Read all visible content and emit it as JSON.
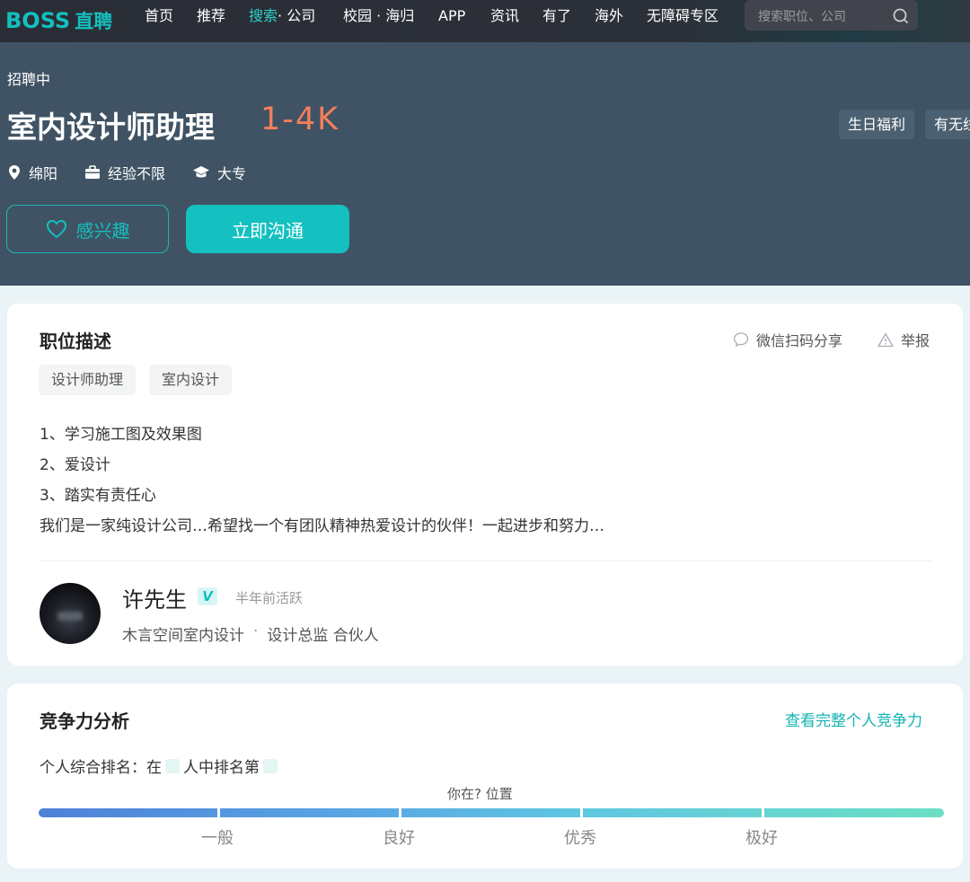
{
  "nav": {
    "logo_main": "BOSS",
    "logo_sub": "直聘",
    "items": [
      "首页",
      "推荐",
      "搜索",
      "· 公司",
      "校园 · 海归",
      "APP",
      "资讯",
      "有了",
      "海外",
      "无障碍专区"
    ],
    "search_placeholder": "搜索职位、公司"
  },
  "job": {
    "status": "招聘中",
    "title": "室内设计师助理",
    "salary": "1-4K",
    "benefits": [
      "生日福利",
      "有无线"
    ],
    "location": "绵阳",
    "experience": "经验不限",
    "education": "大专",
    "like_label": "感兴趣",
    "chat_label": "立即沟通"
  },
  "description": {
    "heading": "职位描述",
    "share_label": "微信扫码分享",
    "report_label": "举报",
    "tags": [
      "设计师助理",
      "室内设计"
    ],
    "lines": [
      "1、学习施工图及效果图",
      "2、爱设计",
      "3、踏实有责任心",
      "我们是一家纯设计公司…希望找一个有团队精神热爱设计的伙伴！一起进步和努力…"
    ]
  },
  "recruiter": {
    "name": "许先生",
    "verified_badge": "V",
    "activity": "半年前活跃",
    "company": "木言空间室内设计",
    "separator": "·",
    "role": "设计总监 合伙人"
  },
  "competitiveness": {
    "heading": "竞争力分析",
    "view_full_label": "查看完整个人竞争力",
    "rank_prefix": "个人综合排名：在",
    "rank_middle": "人中排名第",
    "position_label": "你在? 位置",
    "levels": [
      "一般",
      "良好",
      "优秀",
      "极好"
    ]
  },
  "colors": {
    "accent": "#14bfbf",
    "salary": "#f47e5c",
    "hero_bg": "#3f5364",
    "nav_bg": "#2a2d35"
  }
}
